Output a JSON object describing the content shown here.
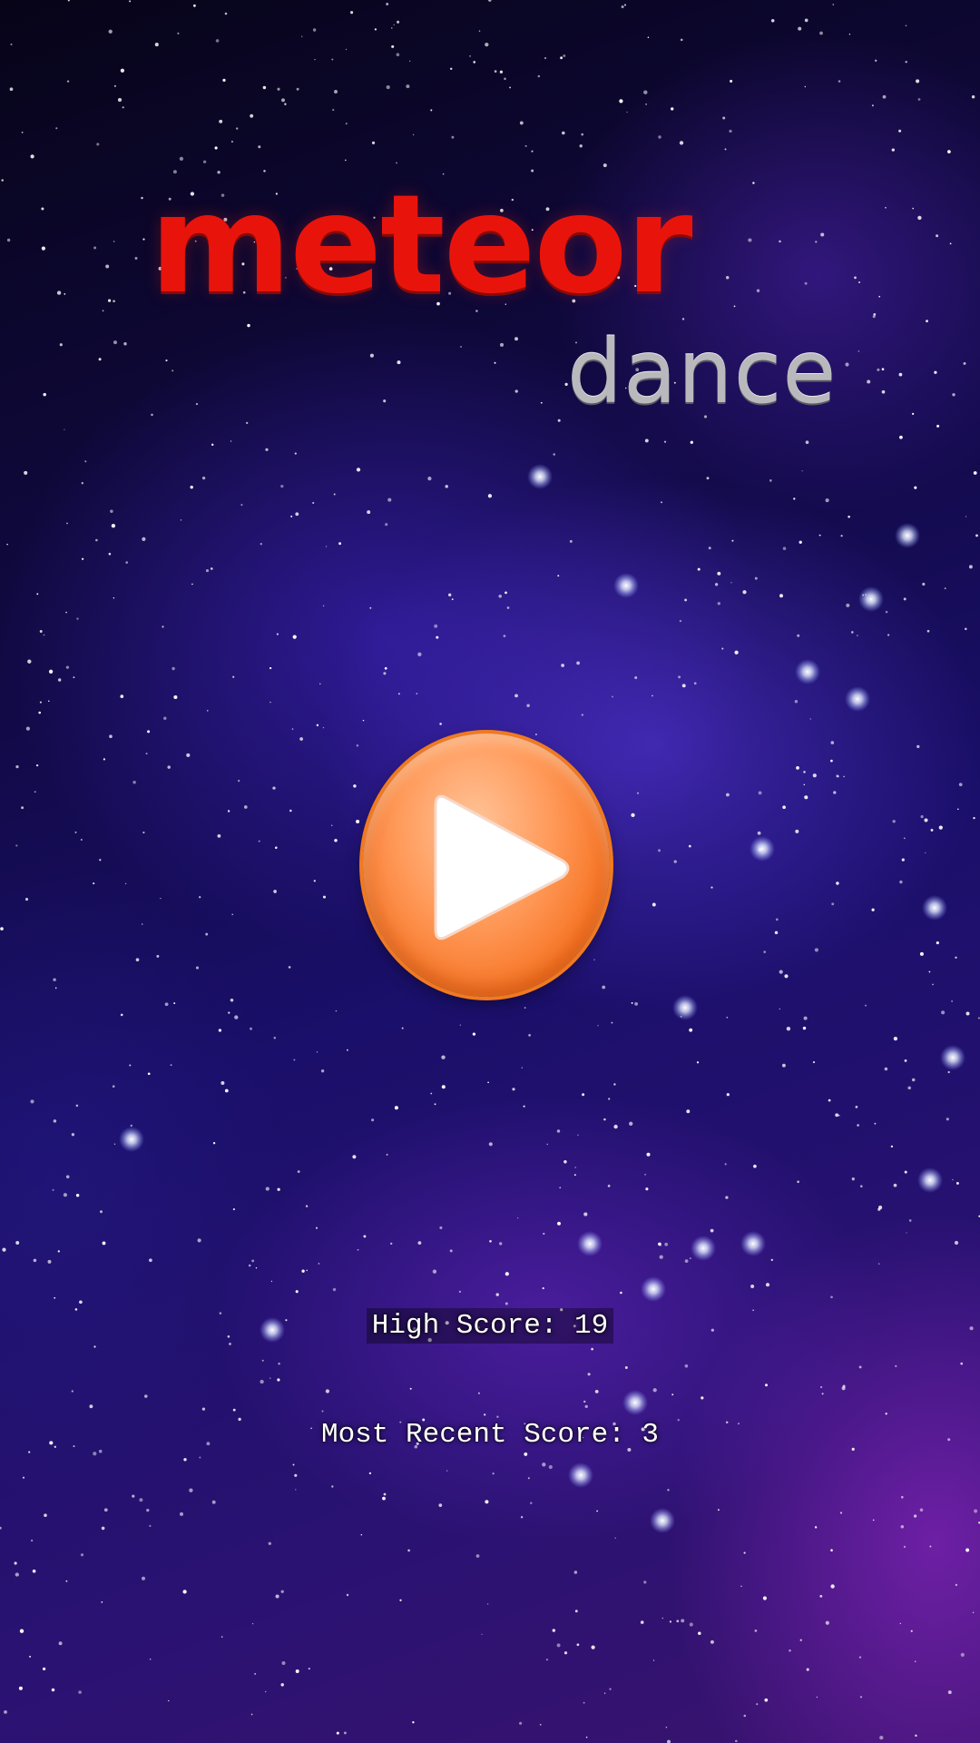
{
  "title": {
    "word1": "meteor",
    "word2": "dance"
  },
  "play_button": {
    "icon": "play-icon",
    "color": "#f6711f"
  },
  "scores": {
    "high_score_label": "High Score: 19",
    "recent_score_label": "Most Recent Score: 3"
  },
  "colors": {
    "title_primary": "#e8140c",
    "title_secondary": "#b9b9bd",
    "background_accent": "#3a22c8"
  }
}
